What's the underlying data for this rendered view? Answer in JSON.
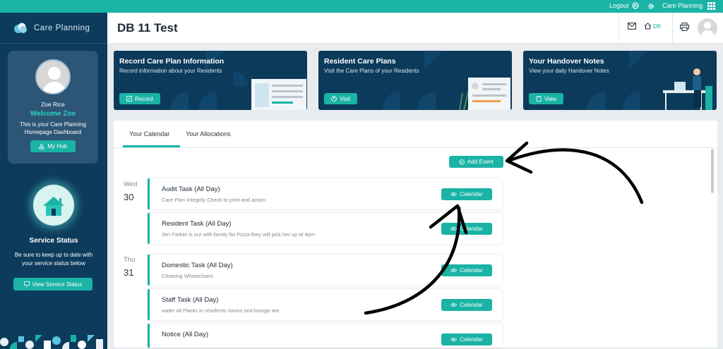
{
  "topbar": {
    "logout_label": "Logout",
    "app_label": "Care Planning"
  },
  "sidebar": {
    "brand": "Care Planning",
    "profile": {
      "name": "Zoe Rice",
      "welcome": "Welcome Zoe",
      "description": "This is your Care Planning Homepage Dashboard",
      "hub_button": "My Hub"
    },
    "service_status": {
      "title": "Service Status",
      "description": "Be sure to keep up to date with your service status below",
      "button": "View Service Status"
    }
  },
  "header": {
    "title": "DB 11 Test",
    "db_label": "DB"
  },
  "cards": [
    {
      "title": "Record Care Plan Information",
      "subtitle": "Record information about your Residents",
      "button": "Record"
    },
    {
      "title": "Resident Care Plans",
      "subtitle": "Visit the Care Plans of your Residents",
      "button": "Visit"
    },
    {
      "title": "Your Handover Notes",
      "subtitle": "View your daily Handover Notes",
      "button": "View"
    }
  ],
  "tabs": [
    {
      "label": "Your Calendar",
      "active": true
    },
    {
      "label": "Your Allocations",
      "active": false
    }
  ],
  "add_event_label": "Add Event",
  "days": [
    {
      "weekday": "Wed",
      "date": "30"
    },
    {
      "weekday": "Thu",
      "date": "31"
    }
  ],
  "events": [
    {
      "title": "Audit Task (All Day)",
      "description": "Care Plan Integrity Check to print and action",
      "button": "Calendar"
    },
    {
      "title": "Resident Task (All Day)",
      "description": "Jen Parker is out with family for Pizza they will pick her up at 4pm",
      "button": "Calendar"
    },
    {
      "title": "Domestic Task (All Day)",
      "description": "Cleaning Wheelchairs",
      "button": "Calendar"
    },
    {
      "title": "Staff Task (All Day)",
      "description": "water all Plants in residents rooms and lounge are",
      "button": "Calendar"
    },
    {
      "title": "Notice (All Day)",
      "description": "",
      "button": "Calendar"
    }
  ],
  "colors": {
    "teal": "#1ab3a6",
    "navy": "#0d3b5c",
    "card_navy": "#0c3a5b"
  }
}
